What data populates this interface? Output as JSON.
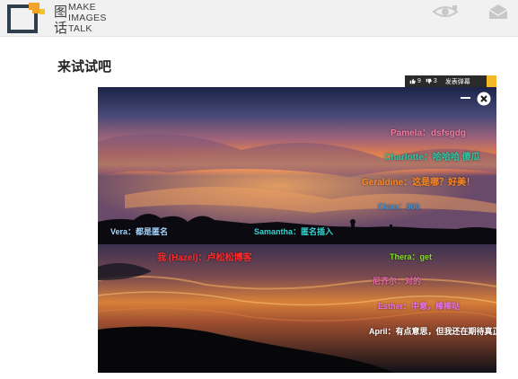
{
  "header": {
    "logo_lines": [
      "MAKE",
      "IMAGES",
      "TALK"
    ],
    "logo_glyphs": [
      "图",
      "话"
    ],
    "icons": [
      "eye-icon",
      "envelope-icon"
    ]
  },
  "page": {
    "title": "来试试吧"
  },
  "toolbar": {
    "likes": "9",
    "dislikes": "3",
    "post_label": "发表弹幕"
  },
  "danmaku": [
    {
      "id": "pamela",
      "text": "Pamela：dsfsgdg",
      "color": "#f07aa0"
    },
    {
      "id": "charlotte",
      "text": "Charlotte：哈哈哈 傻瓜",
      "color": "#2fc4a4"
    },
    {
      "id": "geraldine",
      "text": "Geraldine：这是哪？好美！",
      "color": "#ff8a1f"
    },
    {
      "id": "clara",
      "text": "Clara：666",
      "color": "#3a8ad6"
    },
    {
      "id": "vera",
      "text": "Vera：都是匿名",
      "color": "#a7d8ff"
    },
    {
      "id": "samantha",
      "text": "Samantha：匿名插入",
      "color": "#38d4d0"
    },
    {
      "id": "hazel",
      "text": "我 (Hazel)：卢松松博客",
      "color": "#ff2b2b"
    },
    {
      "id": "thera",
      "text": "Thera：get",
      "color": "#7fe01e"
    },
    {
      "id": "nizi",
      "text": "尼齐尔：对的",
      "color": "#e36aa6"
    },
    {
      "id": "esther",
      "text": "Esther：中意，棒棒哒",
      "color": "#e870e8"
    },
    {
      "id": "april",
      "text": "April：有点意思，但我还在期待真正",
      "color": "#ffffff"
    }
  ]
}
